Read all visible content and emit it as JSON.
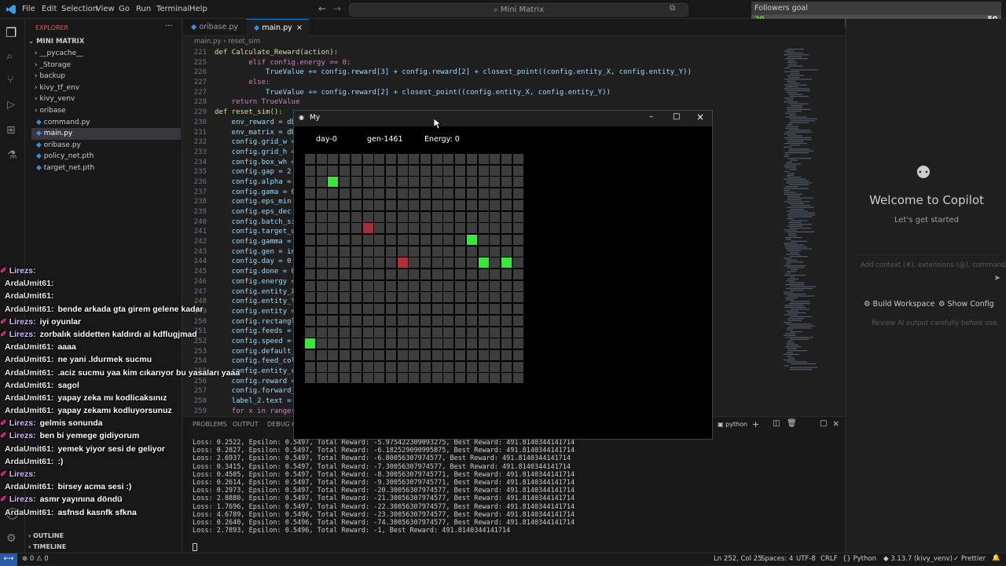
{
  "menu": [
    "File",
    "Edit",
    "Selection",
    "View",
    "Go",
    "Run",
    "Terminal",
    "Help"
  ],
  "command_center": "Mini Matrix",
  "goal": {
    "title": "Followers goal",
    "current": "20",
    "target": "50",
    "progress": 0.4
  },
  "explorer": {
    "title": "EXPLORER",
    "root": "MINI MATRIX",
    "items": [
      "__pycache__",
      "_Storage",
      "backup",
      "kivy_tf_env",
      "kivy_venv",
      "oribase",
      "command.py",
      "main.py",
      "oribase.py",
      "policy_net.pth",
      "target_net.pth"
    ],
    "outline": "OUTLINE",
    "timeline": "TIMELINE"
  },
  "tabs": [
    {
      "label": "oribase.py"
    },
    {
      "label": "main.py"
    }
  ],
  "breadcrumb": {
    "file": "main.py",
    "symbol": "reset_sim"
  },
  "code": [
    {
      "n": "221",
      "t": "def Calculate_Reward(action):"
    },
    {
      "n": "225",
      "t": "        elif config.energy == 0:"
    },
    {
      "n": "226",
      "t": "            TrueValue += config.reward[3] + config.reward[2] + closest_point((config.entity_X, config.entity_Y))"
    },
    {
      "n": "227",
      "t": "        else:"
    },
    {
      "n": "227",
      "t": "            TrueValue += config.reward[2] + closest_point((config.entity_X, config.entity_Y))"
    },
    {
      "n": "228",
      "t": "    return TrueValue"
    },
    {
      "n": "229",
      "t": "def reset_sim():"
    },
    {
      "n": "230",
      "t": "    env_reward = db"
    },
    {
      "n": "231",
      "t": "    env_matrix = db"
    },
    {
      "n": "232",
      "t": "    config.grid_w ="
    },
    {
      "n": "233",
      "t": "    config.grid_h ="
    },
    {
      "n": "234",
      "t": "    config.box_wh ="
    },
    {
      "n": "235",
      "t": "    config.gap = 2"
    },
    {
      "n": "236",
      "t": "    config.alpha ="
    },
    {
      "n": "237",
      "t": "    config.gama = 0"
    },
    {
      "n": "238",
      "t": "    config.eps_min"
    },
    {
      "n": "239",
      "t": "    config.eps_dec"
    },
    {
      "n": "240",
      "t": "    config.batch_si"
    },
    {
      "n": "241",
      "t": "    config.target_u"
    },
    {
      "n": "242",
      "t": "    config.gamma ="
    },
    {
      "n": "243",
      "t": "    config.gen = in"
    },
    {
      "n": "244",
      "t": "    config.day = 0"
    },
    {
      "n": "245",
      "t": "    config.done = 0"
    },
    {
      "n": "246",
      "t": "    config.energy ="
    },
    {
      "n": "247",
      "t": "    config.entity_X"
    },
    {
      "n": "248",
      "t": "    config.entity_Y"
    },
    {
      "n": "249",
      "t": "    config.entity ="
    },
    {
      "n": "250",
      "t": "    config.rectangl"
    },
    {
      "n": "251",
      "t": "    config.feeds ="
    },
    {
      "n": "252",
      "t": "    config.speed ="
    },
    {
      "n": "253",
      "t": "    config.default_"
    },
    {
      "n": "254",
      "t": "    config.feed_col"
    },
    {
      "n": "255",
      "t": "    config.entity_c"
    },
    {
      "n": "256",
      "t": "    config.reward ="
    },
    {
      "n": "257",
      "t": "    config.forward_"
    },
    {
      "n": "258",
      "t": "    label_2.text ="
    },
    {
      "n": "259",
      "t": "    for x in range("
    }
  ],
  "kivy": {
    "title": "My",
    "day": "day-0",
    "gen": "gen-1461",
    "energy": "Energy: 0",
    "grid": {
      "cols": 19,
      "rows": 20
    },
    "green": [
      [
        2,
        2
      ],
      [
        14,
        7
      ],
      [
        15,
        9
      ],
      [
        17,
        9
      ],
      [
        0,
        16
      ]
    ],
    "red": [
      [
        5,
        6
      ],
      [
        8,
        9
      ]
    ],
    "colors": {
      "cell": "#3d3d3d",
      "green": "#39e639",
      "red": "#a0303c",
      "red2": "#b0303a"
    }
  },
  "panel": {
    "tabs": [
      "PROBLEMS",
      "OUTPUT",
      "DEBUG CO"
    ],
    "python_label": "python",
    "lines": [
      "Loss: 0.2522, Epsilon: 0.5497, Total Reward: -5.975422309093275, Best Reward: 491.8140344141714",
      "Loss: 0.2827, Epsilon: 0.5497, Total Reward: -6.182529090995875, Best Reward: 491.8140344141714",
      "Loss: 2.6937, Epsilon: 0.5497, Total Reward: -6.80056307974577, Best Reward: 491.8140344141714",
      "Loss: 0.3415, Epsilon: 0.5497, Total Reward: -7.30056307974577, Best Reward: 491.8140344141714",
      "Loss: 0.4505, Epsilon: 0.5497, Total Reward: -8.300563079745771, Best Reward: 491.8140344141714",
      "Loss: 0.2614, Epsilon: 0.5497, Total Reward: -9.300563079745771, Best Reward: 491.8140344141714",
      "Loss: 0.2973, Epsilon: 0.5497, Total Reward: -20.30056307974577, Best Reward: 491.8140344141714",
      "Loss: 2.8880, Epsilon: 0.5497, Total Reward: -21.30056307974577, Best Reward: 491.8140344141714",
      "Loss: 1.7696, Epsilon: 0.5497, Total Reward: -22.30056307974577, Best Reward: 491.8140344141714",
      "Loss: 4.6789, Epsilon: 0.5496, Total Reward: -23.30056307974577, Best Reward: 491.8140344141714",
      "Loss: 0.2640, Epsilon: 0.5496, Total Reward: -74.30056307974577, Best Reward: 491.8140344141714",
      "Loss: 2.7893, Epsilon: 0.5496, Total Reward: -1, Best Reward: 491.8140344141714"
    ]
  },
  "copilot": {
    "welcome": "Welcome to Copilot",
    "sub": "Let's get started",
    "input_placeholder": "Add context (#), extensions (@), commands",
    "build": "Build Workspace",
    "config": "Show Config",
    "note": "Review AI output carefully before use."
  },
  "chat": [
    {
      "name": "Lirezs:",
      "text": ""
    },
    {
      "name": "ArdaUmit61:",
      "text": ""
    },
    {
      "name": "ArdaUmit61:",
      "text": ""
    },
    {
      "name": "ArdaUmit61:",
      "text": "bende arkada gta girem gelene kadar"
    },
    {
      "name": "Lirezs:",
      "text": "iyi oyunlar"
    },
    {
      "name": "Lirezs:",
      "text": "zorbalık siddetten kaldırdı ai kdflugjmad"
    },
    {
      "name": "ArdaUmit61:",
      "text": "aaaa"
    },
    {
      "name": "ArdaUmit61:",
      "text": "ne yani .ldurmek sucmu"
    },
    {
      "name": "ArdaUmit61:",
      "text": ".aciz sucmu yaa kim cıkarıyor bu yasaları yaaa"
    },
    {
      "name": "ArdaUmit61:",
      "text": "sagol"
    },
    {
      "name": "ArdaUmit61:",
      "text": "yapay zeka mı kodlicaksınız"
    },
    {
      "name": "ArdaUmit61:",
      "text": "yapay zekamı kodluyorsunuz"
    },
    {
      "name": "Lirezs:",
      "text": "gelmis sonunda"
    },
    {
      "name": "Lirezs:",
      "text": "ben bi yemege gidiyorum"
    },
    {
      "name": "ArdaUmit61:",
      "text": "yemek yiyor sesi de geliyor"
    },
    {
      "name": "ArdaUmit61:",
      "text": ":)"
    },
    {
      "name": "Lirezs:",
      "text": ""
    },
    {
      "name": "ArdaUmit61:",
      "text": "birsey acma sesi :)"
    },
    {
      "name": "Lirezs:",
      "text": "asmr yayınına döndü"
    },
    {
      "name": "ArdaUmit61:",
      "text": "asfnsd kasnfk sfkna"
    }
  ],
  "status": {
    "errors": "0",
    "warnings": "0",
    "position": "Ln 252, Col 25",
    "spaces": "Spaces: 4",
    "encoding": "UTF-8",
    "eol": "CRLF",
    "language": "Python",
    "interpreter": "3.13.7 (kivy_venv)",
    "formatter": "Prettier"
  }
}
